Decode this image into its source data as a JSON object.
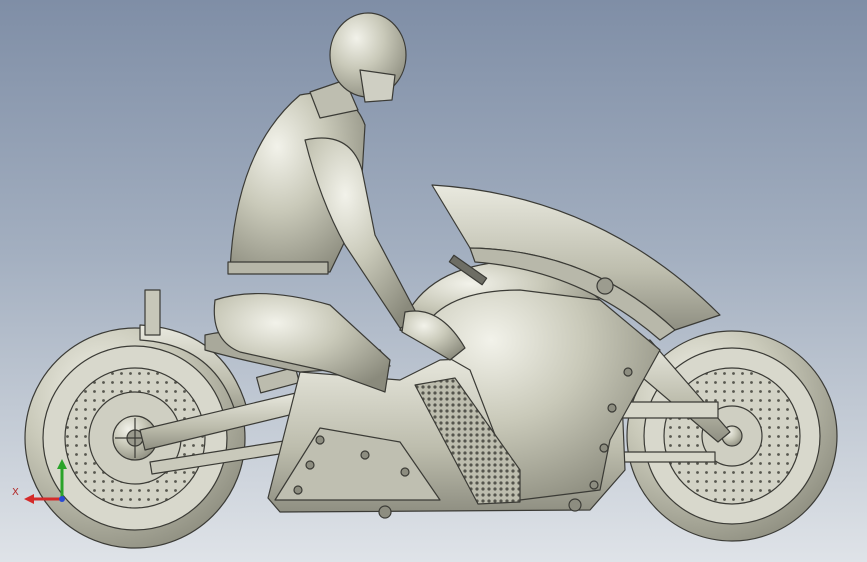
{
  "viewport": {
    "background_top": "#7f8ea6",
    "background_bottom": "#dfe3e8"
  },
  "model": {
    "body_color": "#c9c9b9",
    "edge_color": "#3b3b36"
  },
  "triad": {
    "x_label": "X",
    "x_color": "#d42a2a",
    "y_color": "#2aa32a",
    "z_color": "#2a4ad4"
  }
}
